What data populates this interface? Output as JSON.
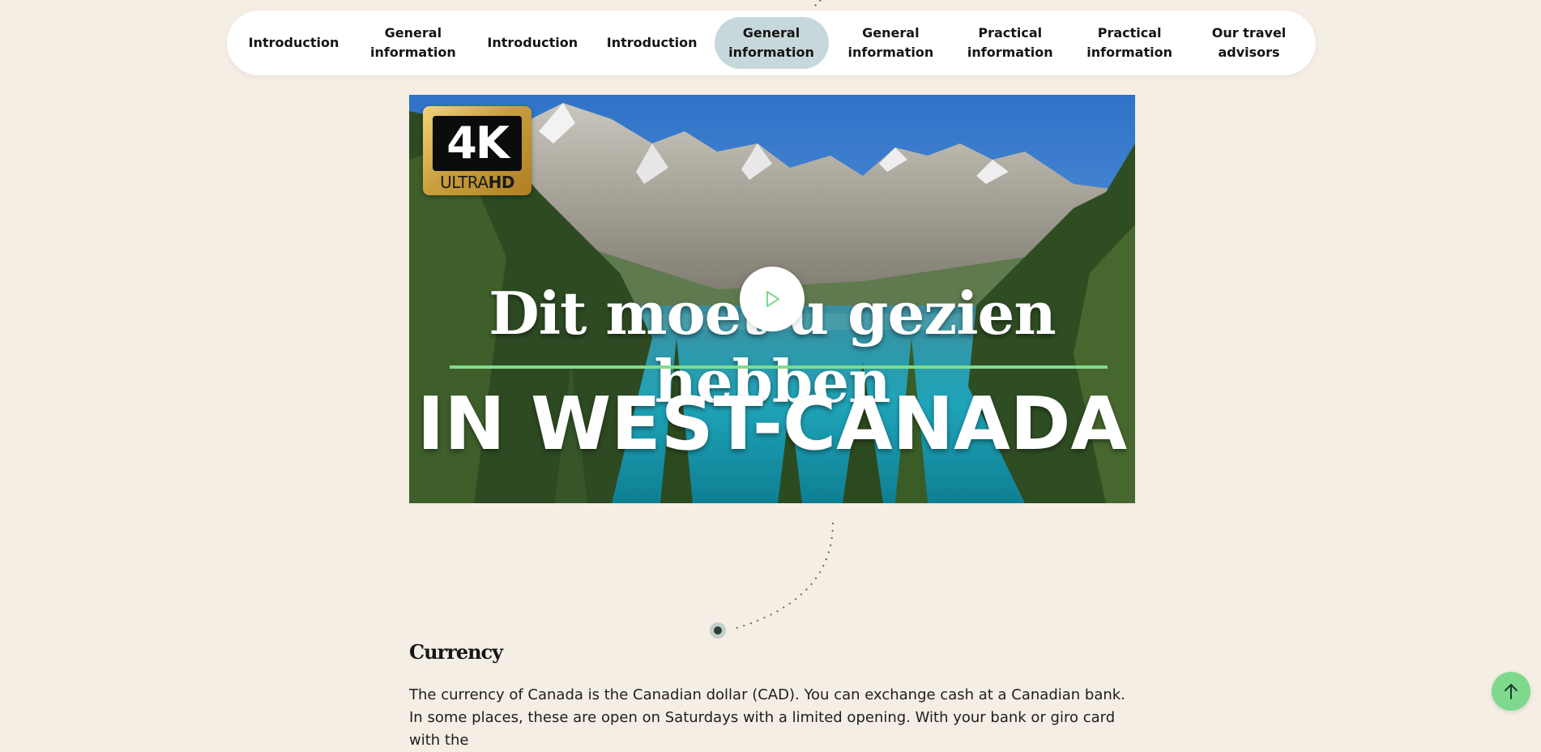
{
  "nav": {
    "items": [
      {
        "label": "Introduction",
        "active": false
      },
      {
        "label": "General information",
        "active": false
      },
      {
        "label": "Introduction",
        "active": false
      },
      {
        "label": "Introduction",
        "active": false
      },
      {
        "label": "General information",
        "active": true
      },
      {
        "label": "General information",
        "active": false
      },
      {
        "label": "Practical information",
        "active": false
      },
      {
        "label": "Practical information",
        "active": false
      },
      {
        "label": "Our travel advisors",
        "active": false
      }
    ]
  },
  "video": {
    "badge_main": "4K",
    "badge_sub_light": "ULTRA",
    "badge_sub_bold": "HD",
    "headline_line1": "Dit moet u gezien hebben",
    "headline_line2": "IN WEST-CANADA",
    "play_icon": "play-icon"
  },
  "section": {
    "title": "Currency",
    "body": "The currency of Canada is the Canadian dollar (CAD). You can exchange cash at a Canadian bank. In some places, these are open on Saturdays with a limited opening. With your bank or giro card with the"
  },
  "scroll_top": {
    "icon": "arrow-up-icon"
  },
  "colors": {
    "page_bg": "#f5eee5",
    "nav_bg": "#ffffff",
    "nav_active_bg": "#c6d8db",
    "accent_green": "#7fd98d",
    "text": "#1b1b1b"
  }
}
